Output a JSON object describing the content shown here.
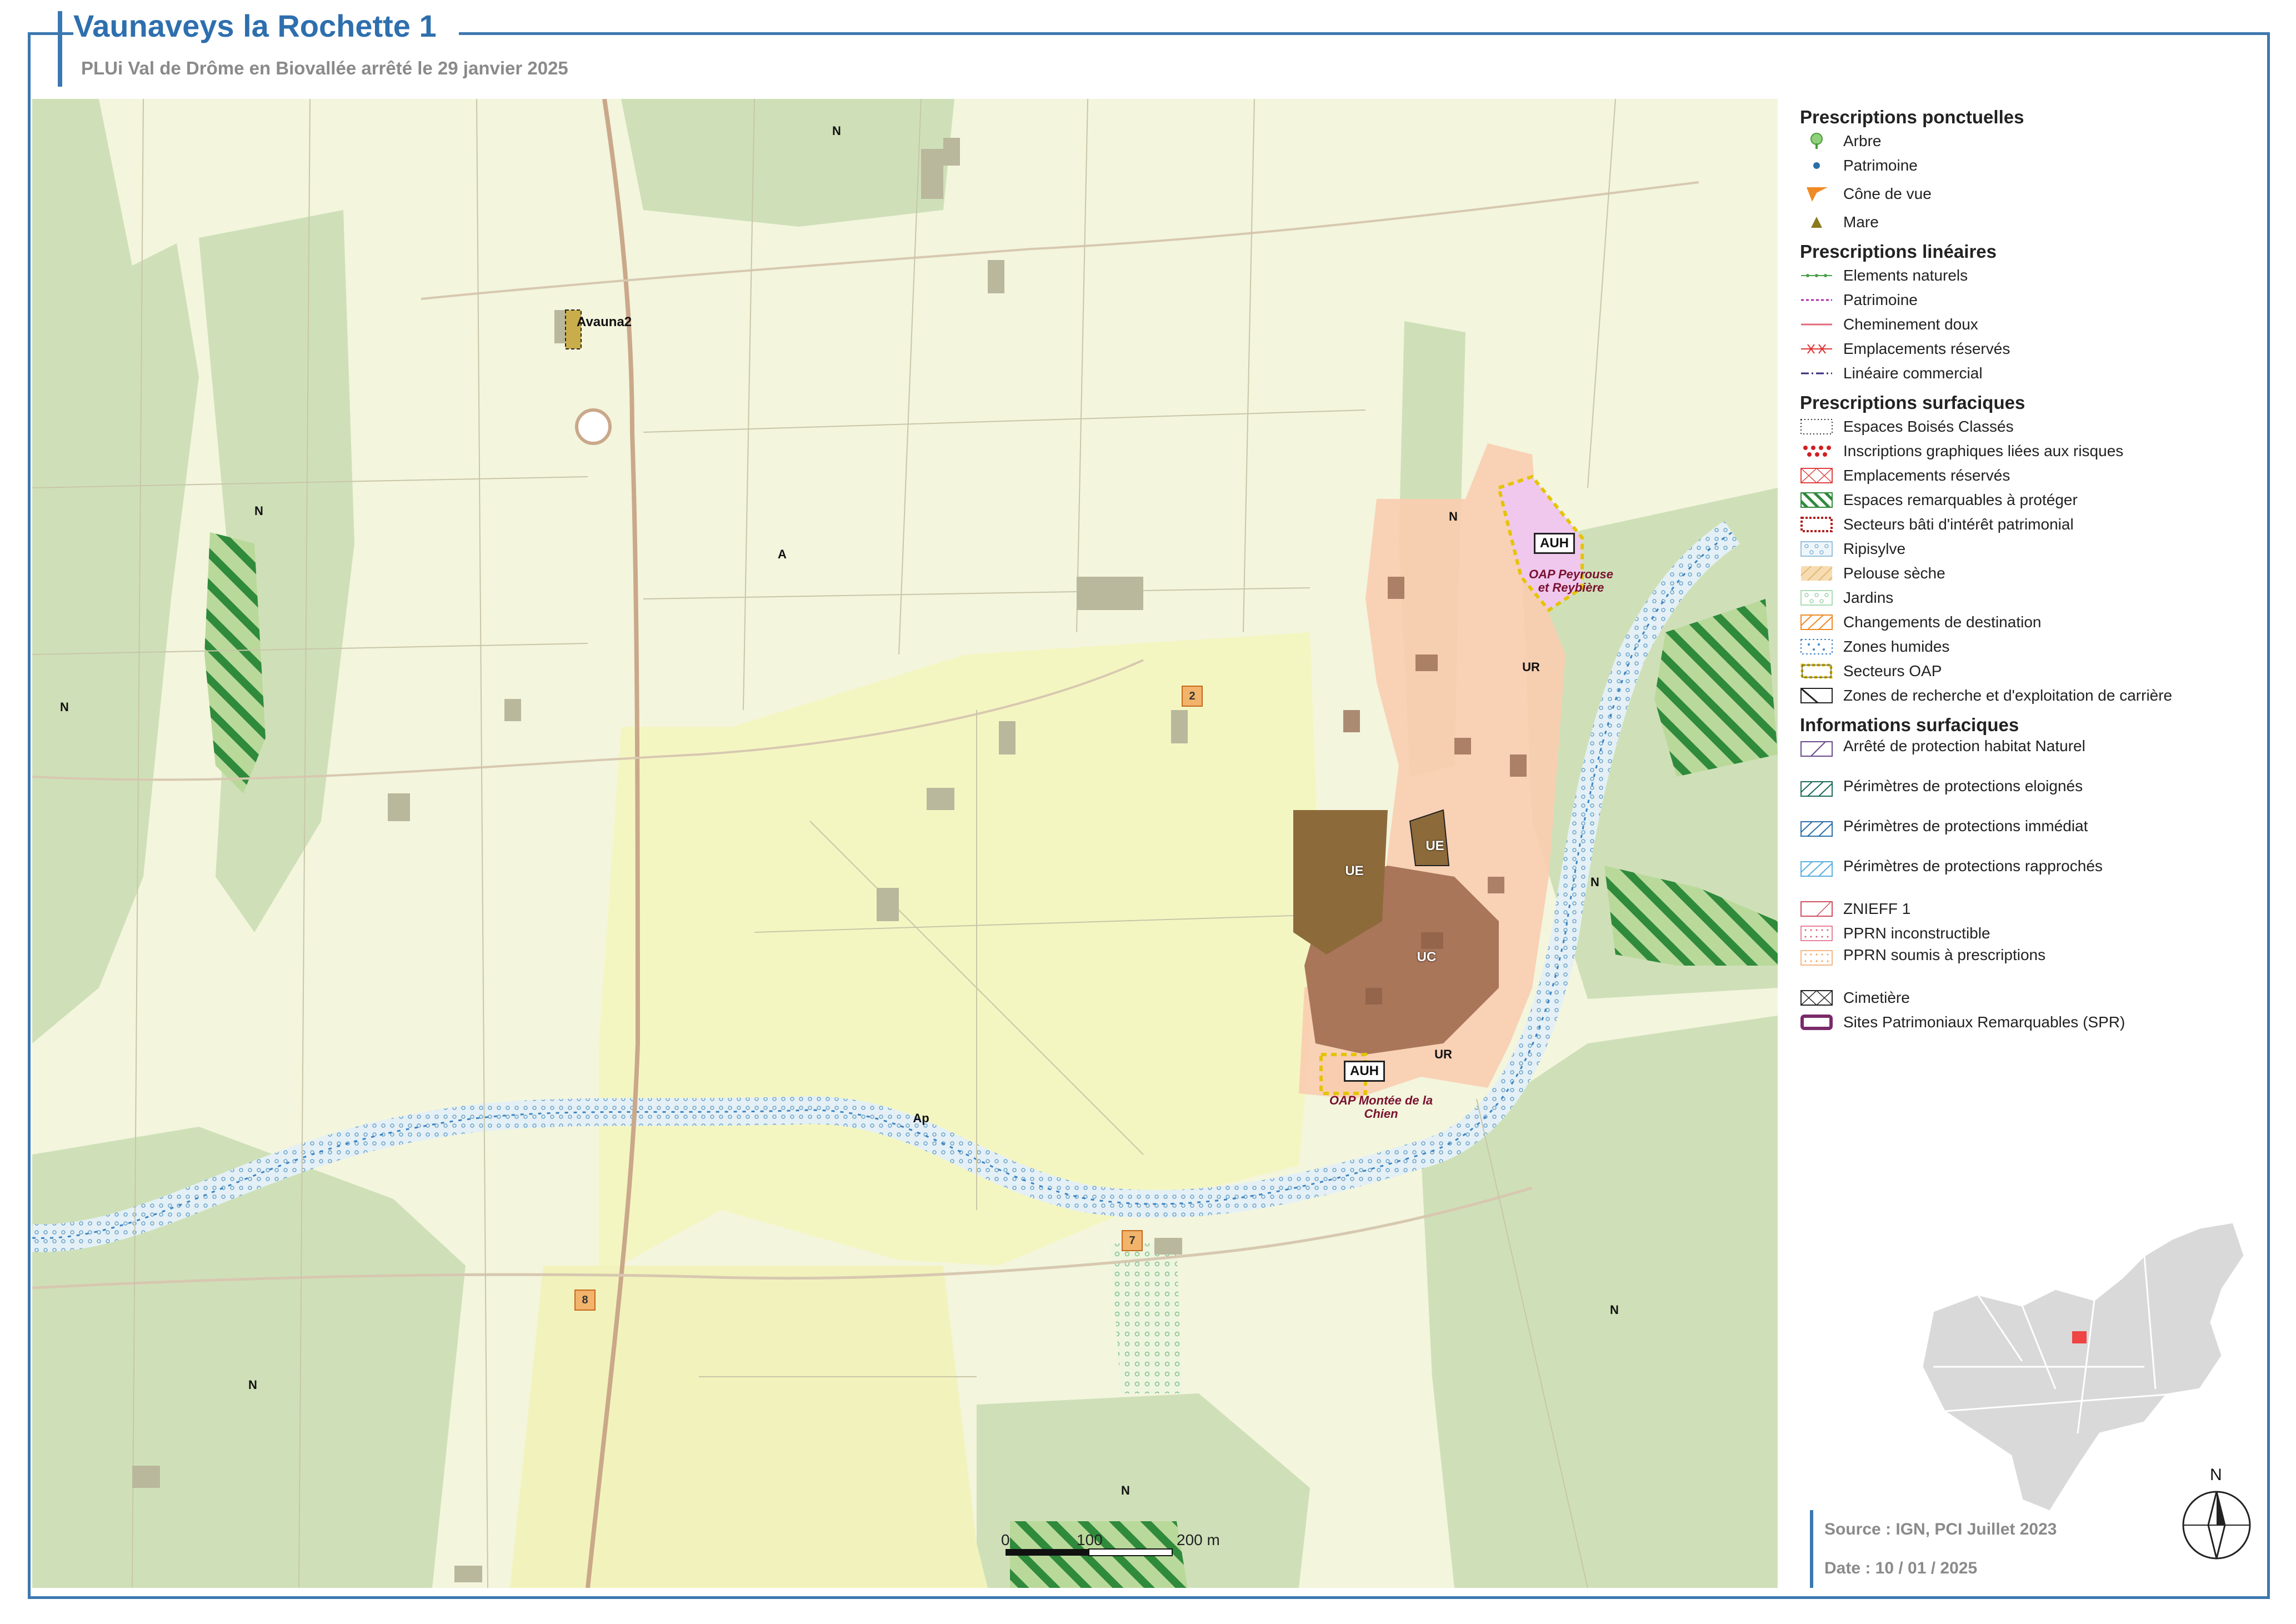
{
  "header": {
    "title": "Vaunaveys la Rochette 1",
    "subtitle": "PLUi Val de Drôme en Biovallée arrêté le 29 janvier 2025"
  },
  "map": {
    "zones": {
      "n_top": "N",
      "n_left1": "N",
      "n_left2": "N",
      "n_bottom_left": "N",
      "n_bottom": "N",
      "n_right1": "N",
      "n_right2": "N",
      "n_village": "N",
      "a": "A",
      "ap": "Ap",
      "ue1": "UE",
      "ue2": "UE",
      "uc": "UC",
      "ur1": "UR",
      "ur2": "UR",
      "auh1": "AUH",
      "auh2": "AUH"
    },
    "oap_labels": {
      "peyrouse": "OAP Peyrouse et Reybière",
      "montee": "OAP Montée de la Chien"
    },
    "site_label": "Avauna2",
    "badges": [
      "2",
      "7",
      "8"
    ],
    "scale": {
      "zero": "0",
      "mid": "100",
      "end": "200 m"
    }
  },
  "legend": {
    "ponctuelles": {
      "title": "Prescriptions ponctuelles",
      "items": [
        "Arbre",
        "Patrimoine",
        "Cône de vue",
        "Mare"
      ]
    },
    "lineaires": {
      "title": "Prescriptions linéaires",
      "items": [
        "Elements naturels",
        "Patrimoine",
        "Cheminement doux",
        "Emplacements réservés",
        "Linéaire commercial"
      ]
    },
    "surfaciques": {
      "title": "Prescriptions surfaciques",
      "items": [
        "Espaces Boisés Classés",
        "Inscriptions graphiques liées aux risques",
        "Emplacements réservés",
        "Espaces remarquables à protéger",
        "Secteurs bâti d'intérêt patrimonial",
        "Ripisylve",
        "Pelouse sèche",
        "Jardins",
        "Changements de destination",
        "Zones humides",
        "Secteurs OAP",
        "Zones de recherche et d'exploitation de carrière"
      ]
    },
    "informations": {
      "title": "Informations surfaciques",
      "items": [
        "Arrêté de protection habitat Naturel",
        "Périmètres de protections eloignés",
        "Périmètres de protections immédiat",
        "Périmètres de protections rapprochés",
        "ZNIEFF 1",
        "PPRN inconstructible",
        "PPRN soumis à prescriptions",
        "Cimetière",
        "Sites Patrimoniaux Remarquables (SPR)"
      ]
    }
  },
  "footer": {
    "source": "Source : IGN, PCI Juillet 2023",
    "date": "Date : 10 / 01 / 2025"
  },
  "north_label": "N",
  "colors": {
    "frame": "#3b78b0",
    "agri": "#f3f5dd",
    "natural": "#cfe0b8",
    "ap": "#f4f6c2",
    "ur": "#f9cdb0",
    "uc": "#a9765a",
    "ue": "#8d6a3a",
    "auh": "#f0c8ee",
    "river": "#7aaed3"
  }
}
